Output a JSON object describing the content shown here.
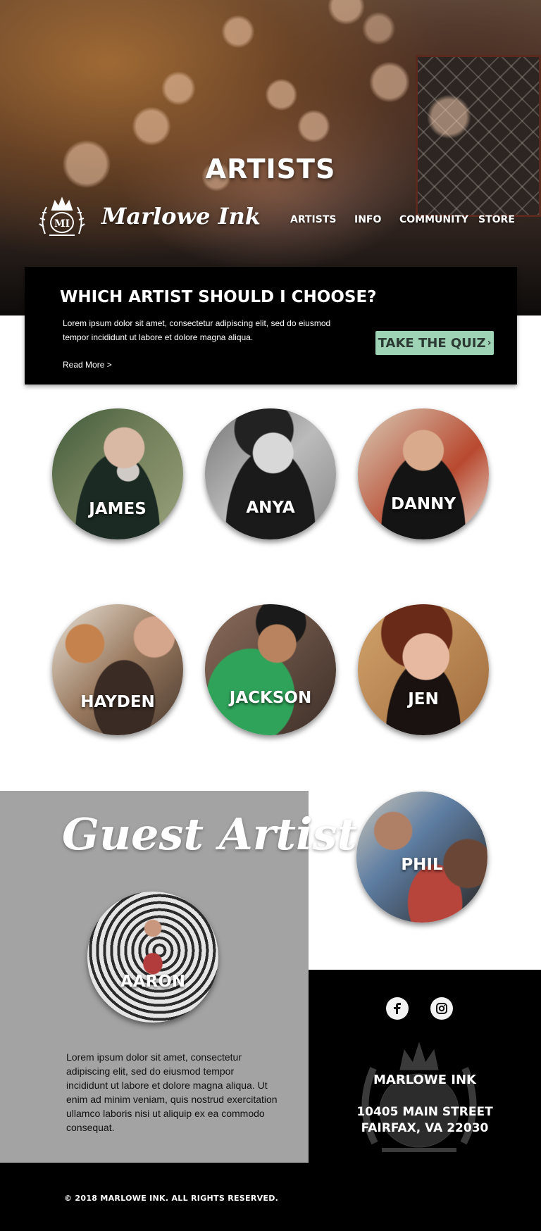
{
  "hero": {
    "title": "ARTISTS"
  },
  "brand": {
    "name": "Marlowe Ink",
    "emblem_icon": "crown-crest-icon"
  },
  "nav": {
    "items": [
      "ARTISTS",
      "INFO",
      "COMMUNITY",
      "STORE"
    ]
  },
  "quiz": {
    "heading": "WHICH ARTIST SHOULD I CHOOSE?",
    "body": "Lorem ipsum dolor sit amet, consectetur adipiscing elit, sed do eiusmod tempor incididunt ut labore et dolore magna aliqua.",
    "read_more": "Read More >",
    "button": "TAKE THE QUIZ",
    "button_icon": "chevron-right-icon",
    "button_color": "#9fd3b5"
  },
  "artists": [
    {
      "name": "JAMES"
    },
    {
      "name": "ANYA"
    },
    {
      "name": "DANNY"
    },
    {
      "name": "HAYDEN"
    },
    {
      "name": "JACKSON"
    },
    {
      "name": "JEN"
    },
    {
      "name": "PHIL"
    }
  ],
  "guest": {
    "title": "Guest Artist",
    "artist_name": "AARON",
    "body": "Lorem ipsum dolor sit amet, consectetur adipiscing elit, sed do eiusmod tempor incididunt ut labore et dolore magna aliqua. Ut enim ad minim veniam, quis nostrud exercitation ullamco laboris nisi ut aliquip ex ea commodo consequat.",
    "background_color": "#a3a3a3"
  },
  "contact": {
    "social_icons": [
      "facebook-icon",
      "instagram-icon"
    ],
    "name": "MARLOWE INK",
    "address_line1": "10405 MAIN STREET",
    "address_line2": "FAIRFAX, VA 22030"
  },
  "footer": {
    "copyright": "© 2018 MARLOWE INK. ALL RIGHTS RESERVED."
  }
}
